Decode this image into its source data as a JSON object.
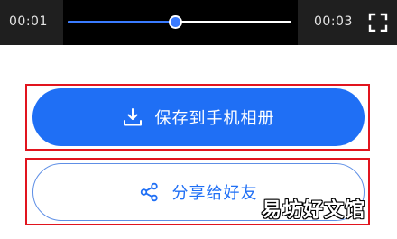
{
  "player": {
    "current_time": "00:01",
    "total_time": "00:03",
    "progress": 0.48,
    "accent_color": "#3a7bff",
    "fullscreen_icon": "fullscreen-icon"
  },
  "actions": {
    "save_label": "保存到手机相册",
    "save_icon": "download-icon",
    "save_color": "#1f6ff5",
    "share_label": "分享给好友",
    "share_icon": "share-icon",
    "highlight_color": "#e1141e"
  },
  "watermark": {
    "text": "易坊好文馆"
  }
}
